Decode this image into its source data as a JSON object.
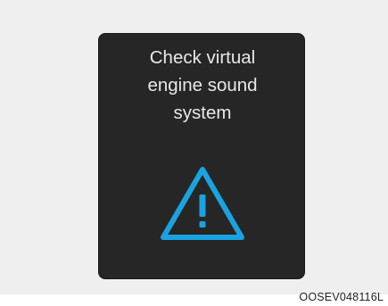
{
  "warning_display": {
    "message": "Check virtual\nengine sound\nsystem",
    "icon": "warning-triangle-icon",
    "icon_color": "#1aa3df",
    "background_color": "#262626",
    "text_color": "#e8e8e8"
  },
  "image_code": "OOSEV048116L"
}
